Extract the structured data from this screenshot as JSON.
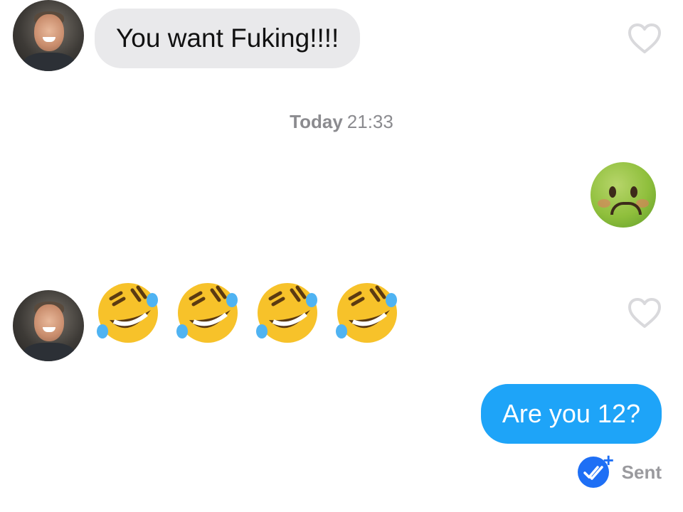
{
  "messages": {
    "incoming_1": {
      "text": "You want Fuking!!!!"
    },
    "timestamp": {
      "day": "Today",
      "time": "21:33"
    },
    "outgoing_emoji": {
      "emoji": "🤢",
      "icon": "nauseated-face-icon"
    },
    "incoming_2": {
      "emoji": [
        "🤣",
        "🤣",
        "🤣",
        "🤣"
      ],
      "icon": "rolling-on-floor-laughing-icon"
    },
    "outgoing_1": {
      "text": "Are you 12?"
    },
    "status": {
      "label": "Sent",
      "icon": "double-check-icon",
      "plus": "+"
    }
  },
  "colors": {
    "incoming_bubble": "#e9e9eb",
    "outgoing_bubble": "#1ea4f8",
    "sent_check": "#1e6ff5"
  }
}
